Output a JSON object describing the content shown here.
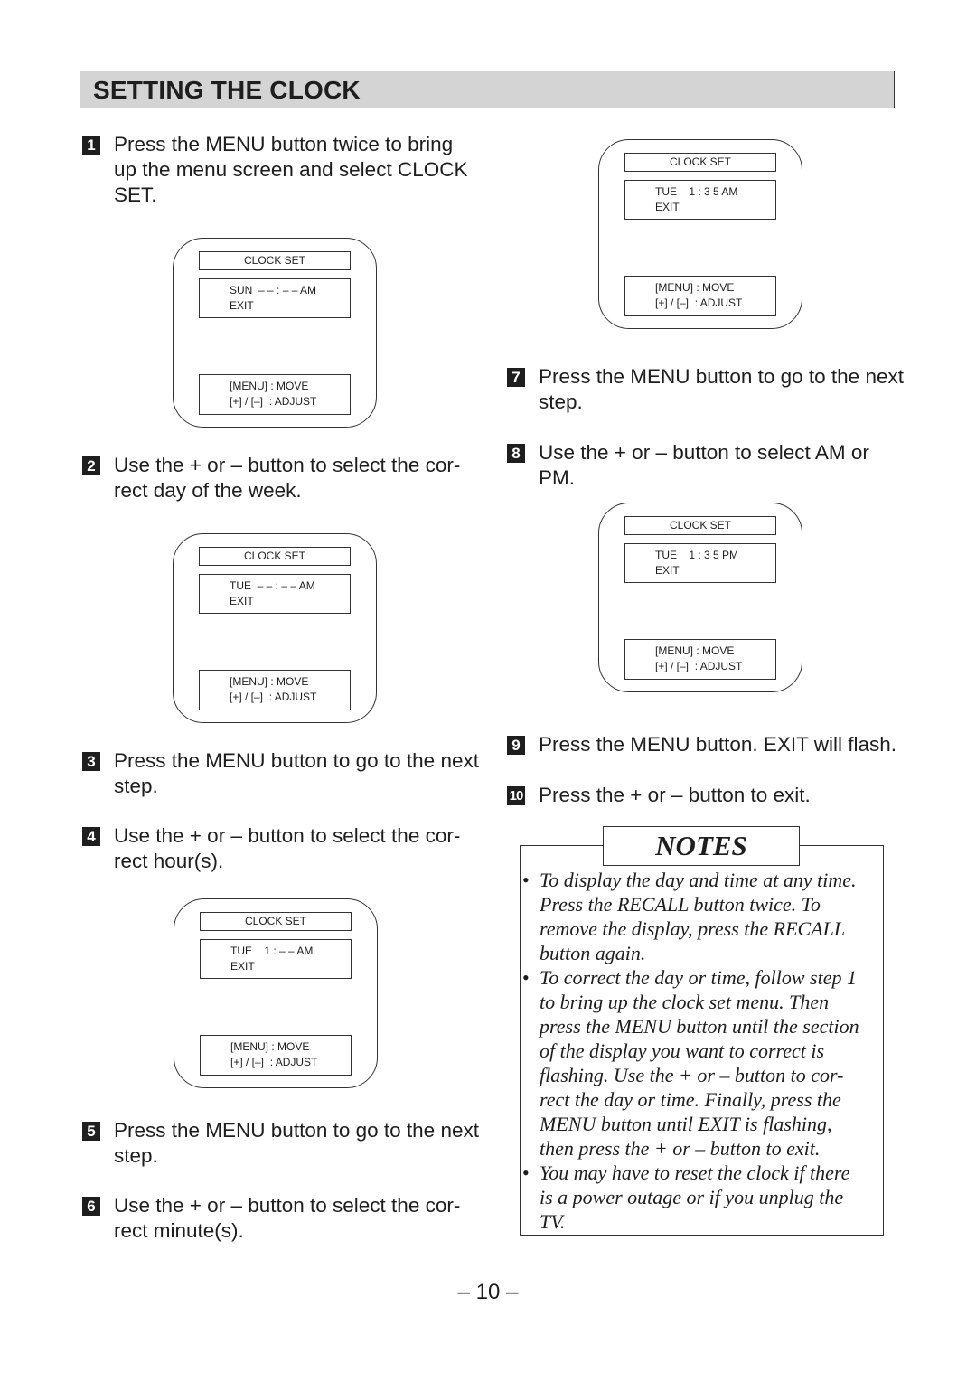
{
  "header": {
    "title": "SETTING THE CLOCK"
  },
  "steps": [
    {
      "num": "1",
      "lines": [
        "Press the MENU button twice to bring",
        "up the menu screen and select CLOCK",
        "SET."
      ]
    },
    {
      "num": "2",
      "lines": [
        "Use the + or – button to select the cor-",
        "rect day of the week."
      ]
    },
    {
      "num": "3",
      "lines": [
        "Press the MENU button to go to the next",
        "step."
      ]
    },
    {
      "num": "4",
      "lines": [
        "Use the + or – button to select the cor-",
        "rect hour(s)."
      ]
    },
    {
      "num": "5",
      "lines": [
        "Press the MENU button to go to the next",
        "step."
      ]
    },
    {
      "num": "6",
      "lines": [
        "Use the + or – button to select the cor-",
        "rect minute(s)."
      ]
    },
    {
      "num": "7",
      "lines": [
        "Press the MENU button to go to the next",
        "step."
      ]
    },
    {
      "num": "8",
      "lines": [
        "Use the + or – button to select AM or",
        "PM."
      ]
    },
    {
      "num": "9",
      "lines": [
        "Press the MENU button. EXIT will flash."
      ]
    },
    {
      "num": "10",
      "lines": [
        "Press the + or – button to exit."
      ]
    }
  ],
  "screens": [
    {
      "title": "CLOCK SET",
      "main": [
        "SUN  – – : – – AM",
        "EXIT"
      ],
      "help": [
        "[MENU] : MOVE",
        "[+] / [–]  : ADJUST"
      ]
    },
    {
      "title": "CLOCK SET",
      "main": [
        "TUE  – – : – – AM",
        "EXIT"
      ],
      "help": [
        "[MENU] : MOVE",
        "[+] / [–]  : ADJUST"
      ]
    },
    {
      "title": "CLOCK SET",
      "main": [
        "TUE    1 : – – AM",
        "EXIT"
      ],
      "help": [
        "[MENU] : MOVE",
        "[+] / [–]  : ADJUST"
      ]
    },
    {
      "title": "CLOCK SET",
      "main": [
        "TUE    1 : 3 5 AM",
        "EXIT"
      ],
      "help": [
        "[MENU] : MOVE",
        "[+] / [–]  : ADJUST"
      ]
    },
    {
      "title": "CLOCK SET",
      "main": [
        "TUE    1 : 3 5 PM",
        "EXIT"
      ],
      "help": [
        "[MENU] : MOVE",
        "[+] / [–]  : ADJUST"
      ]
    }
  ],
  "notes": {
    "title": "NOTES",
    "bullet": "•",
    "items": [
      [
        "To display the day and time at any time.",
        "Press the RECALL button twice. To",
        "remove the display, press the RECALL",
        "button again."
      ],
      [
        "To correct the day or time, follow step 1",
        "to bring up the clock set menu. Then",
        "press the MENU button until the section",
        "of the display you want to correct is",
        "flashing. Use the + or – button to cor-",
        "rect the day or time. Finally, press the",
        "MENU button until EXIT is flashing,",
        "then press the + or – button to exit."
      ],
      [
        "You may have to reset the clock if there",
        "is a power outage or if you unplug the",
        "TV."
      ]
    ]
  },
  "page_number": "– 10 –"
}
